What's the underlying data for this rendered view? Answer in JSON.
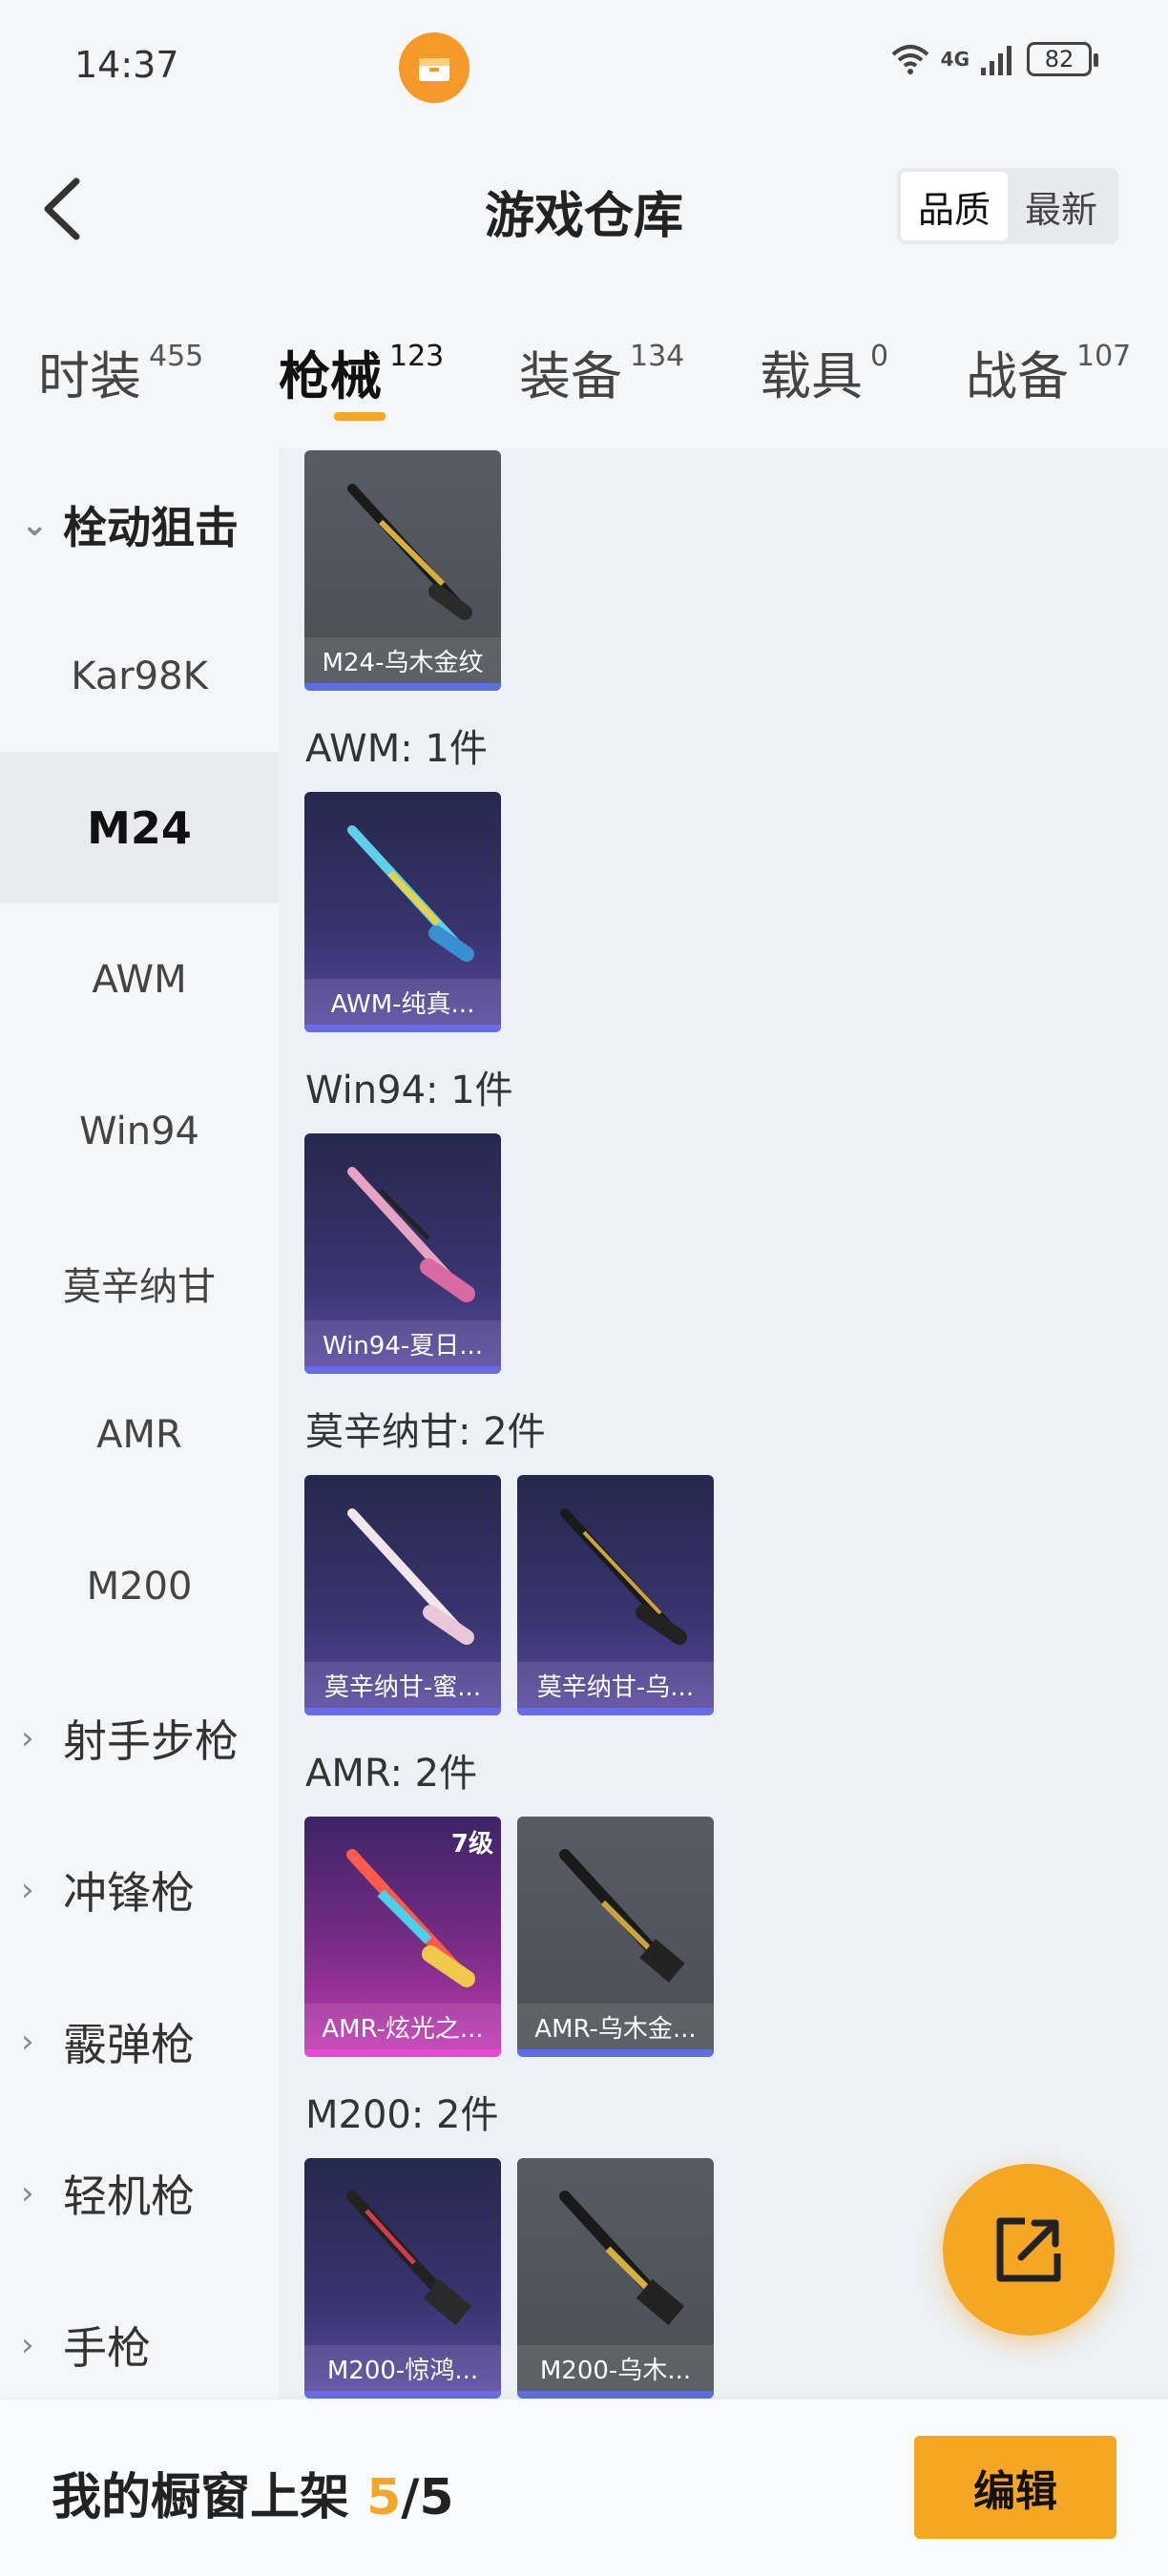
{
  "status_bar": {
    "time": "14:37",
    "network": "4G",
    "battery": "82"
  },
  "header": {
    "title": "游戏仓库",
    "sort_options": [
      "品质",
      "最新"
    ],
    "sort_active": "品质"
  },
  "tabs": [
    {
      "label": "时装",
      "count": "455"
    },
    {
      "label": "枪械",
      "count": "123",
      "active": true
    },
    {
      "label": "装备",
      "count": "134"
    },
    {
      "label": "载具",
      "count": "0"
    },
    {
      "label": "战备",
      "count": "107"
    }
  ],
  "sidebar": {
    "open_category": "栓动狙击",
    "sub_items": [
      "Kar98K",
      "M24",
      "AWM",
      "Win94",
      "莫辛纳甘",
      "AMR",
      "M200"
    ],
    "selected": "M24",
    "categories": [
      "射手步枪",
      "冲锋枪",
      "霰弹枪",
      "轻机枪",
      "手枪"
    ]
  },
  "content": {
    "groups": [
      {
        "title": "",
        "items": [
          {
            "name": "M24-乌木金纹",
            "rarity": "grey"
          }
        ]
      },
      {
        "title": "AWM: 1件",
        "items": [
          {
            "name": "AWM-纯真...",
            "rarity": "purple"
          }
        ]
      },
      {
        "title": "Win94: 1件",
        "items": [
          {
            "name": "Win94-夏日...",
            "rarity": "purple"
          }
        ]
      },
      {
        "title": "莫辛纳甘: 2件",
        "items": [
          {
            "name": "莫辛纳甘-蜜...",
            "rarity": "purple"
          },
          {
            "name": "莫辛纳甘-乌...",
            "rarity": "purple"
          }
        ]
      },
      {
        "title": "AMR: 2件",
        "items": [
          {
            "name": "AMR-炫光之...",
            "rarity": "pink",
            "level": "7级"
          },
          {
            "name": "AMR-乌木金...",
            "rarity": "grey"
          }
        ]
      },
      {
        "title": "M200: 2件",
        "items": [
          {
            "name": "M200-惊鸿...",
            "rarity": "purple"
          },
          {
            "name": "M200-乌木...",
            "rarity": "grey"
          }
        ]
      }
    ]
  },
  "bottom_bar": {
    "label": "我的橱窗上架",
    "count_current": "5",
    "count_sep": "/",
    "count_total": "5",
    "edit_label": "编辑"
  },
  "colors": {
    "accent": "#f5a623",
    "grey_card": "#53565d",
    "purple_card": "#3a3470",
    "pink_card": "#c53ab4"
  },
  "icons": {
    "back": "chevron-left-icon",
    "share": "share-external-icon",
    "app": "orange-box-app-icon"
  }
}
